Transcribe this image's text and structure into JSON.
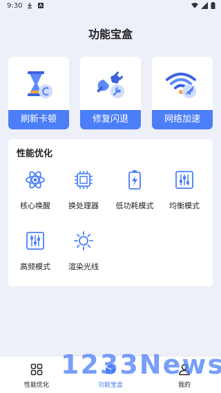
{
  "status_bar": {
    "time": "9:30"
  },
  "title": "功能宝盒",
  "quick_actions": [
    {
      "label": "刷新卡顿",
      "icon": "hourglass-refresh-icon"
    },
    {
      "label": "修复闪退",
      "icon": "plug-wrench-icon"
    },
    {
      "label": "网络加速",
      "icon": "wifi-rocket-icon"
    }
  ],
  "panel": {
    "title": "性能优化",
    "tools": [
      {
        "label": "核心唤醒",
        "icon": "atom-icon"
      },
      {
        "label": "换处理器",
        "icon": "cpu-chip-icon"
      },
      {
        "label": "低功耗模式",
        "icon": "battery-bolt-icon"
      },
      {
        "label": "均衡模式",
        "icon": "sliders-icon"
      },
      {
        "label": "高频模式",
        "icon": "sliders-box-icon"
      },
      {
        "label": "渲染光线",
        "icon": "sun-icon"
      }
    ]
  },
  "tabs": [
    {
      "label": "性能优化",
      "icon": "grid-icon",
      "active": false
    },
    {
      "label": "功能宝盒",
      "icon": "box-icon",
      "active": true
    },
    {
      "label": "我的",
      "icon": "person-icon",
      "active": false
    }
  ],
  "watermark": "1233News",
  "colors": {
    "accent": "#4b7ef7",
    "background": "#eef0f9"
  }
}
